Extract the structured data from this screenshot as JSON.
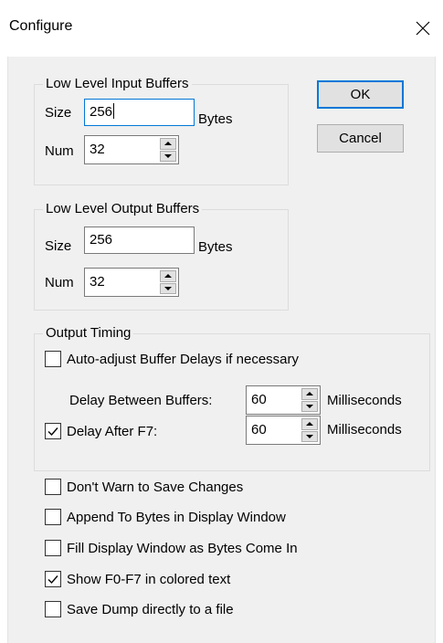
{
  "window": {
    "title": "Configure",
    "close_label": "✕"
  },
  "input_buffers": {
    "label": "Low Level Input Buffers",
    "size_label": "Size",
    "size_value": "256",
    "size_units": "Bytes",
    "num_label": "Num",
    "num_value": "32"
  },
  "output_buffers": {
    "label": "Low Level Output Buffers",
    "size_label": "Size",
    "size_value": "256",
    "size_units": "Bytes",
    "num_label": "Num",
    "num_value": "32"
  },
  "buttons": {
    "ok": "OK",
    "cancel": "Cancel"
  },
  "output_timing": {
    "label": "Output Timing",
    "auto_adjust": {
      "label": "Auto-adjust Buffer Delays if necessary",
      "checked": false
    },
    "delay_between": {
      "label": "Delay Between Buffers:",
      "value": "60",
      "units": "Milliseconds"
    },
    "delay_after": {
      "label": "Delay After F7:",
      "checked": true,
      "value": "60",
      "units": "Milliseconds"
    }
  },
  "options": [
    {
      "label": "Don't Warn to Save Changes",
      "checked": false
    },
    {
      "label": "Append To Bytes in Display Window",
      "checked": false
    },
    {
      "label": "Fill Display Window as Bytes Come In",
      "checked": false
    },
    {
      "label": "Show F0-F7 in colored text",
      "checked": true
    },
    {
      "label": "Save Dump directly to a file",
      "checked": false
    }
  ],
  "colors": {
    "accent": "#0078d7",
    "dialog_bg": "#f0f0f0",
    "button_bg": "#e1e1e1"
  }
}
